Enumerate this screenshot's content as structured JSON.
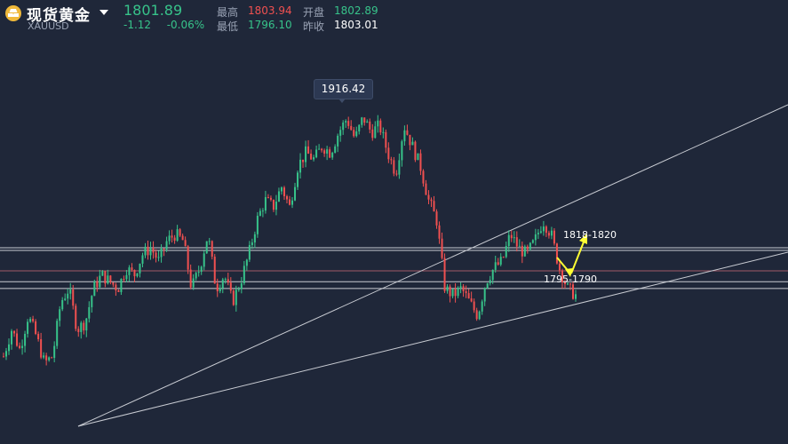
{
  "header": {
    "title": "现货黄金",
    "symbol": "XAUUSD",
    "price": "1801.89",
    "change": "-1.12",
    "change_pct": "-0.06%",
    "stats": {
      "high_label": "最高",
      "high": "1803.94",
      "open_label": "开盘",
      "open": "1802.89",
      "low_label": "最低",
      "low": "1796.10",
      "prev_close_label": "昨收",
      "prev_close": "1803.01"
    }
  },
  "colors": {
    "up": "#37c38a",
    "down": "#f05050",
    "background": "#1f2739",
    "arrow": "#ffff33"
  },
  "chart_data": {
    "type": "candlestick",
    "peak_label": "1916.42",
    "annotations": [
      "1818-1820",
      "1795-1790"
    ],
    "horizontal_levels": [
      1820,
      1818,
      1803.01,
      1795,
      1790
    ],
    "y": [
      1740,
      1760,
      1745,
      1770,
      1755,
      1735,
      1740,
      1780,
      1790,
      1760,
      1765,
      1790,
      1800,
      1795,
      1790,
      1805,
      1800,
      1815,
      1820,
      1810,
      1825,
      1830,
      1825,
      1790,
      1805,
      1830,
      1790,
      1800,
      1780,
      1795,
      1815,
      1840,
      1855,
      1850,
      1865,
      1850,
      1880,
      1890,
      1885,
      1895,
      1890,
      1905,
      1915,
      1900,
      1916,
      1905,
      1910,
      1890,
      1875,
      1910,
      1895,
      1880,
      1855,
      1840,
      1790,
      1785,
      1790,
      1780,
      1770,
      1795,
      1805,
      1810,
      1830,
      1820,
      1815,
      1825,
      1840,
      1830,
      1805,
      1790,
      1785
    ]
  }
}
